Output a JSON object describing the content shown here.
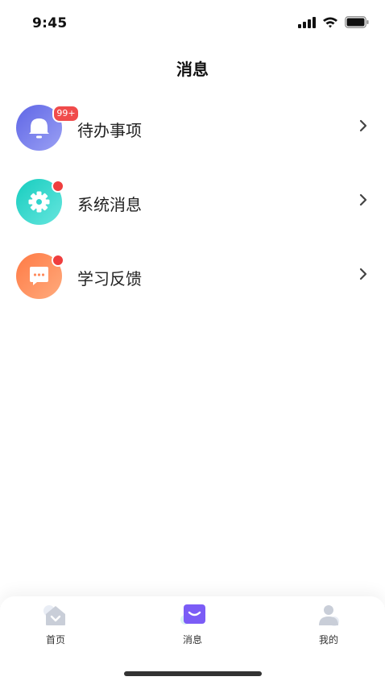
{
  "status_bar": {
    "time": "9:45"
  },
  "header": {
    "title": "消息"
  },
  "messages": [
    {
      "label": "待办事项",
      "icon": "bell-icon",
      "badge": "99+",
      "color": "#6e73ea"
    },
    {
      "label": "系统消息",
      "icon": "gear-icon",
      "color": "#2fd4cd"
    },
    {
      "label": "学习反馈",
      "icon": "chat-bubble-icon",
      "color": "#ff8a5c"
    }
  ],
  "tabbar": {
    "items": [
      {
        "label": "首页",
        "icon": "home-icon"
      },
      {
        "label": "消息",
        "icon": "message-icon",
        "active": true,
        "color": "#7b5cf6"
      },
      {
        "label": "我的",
        "icon": "profile-icon"
      }
    ]
  }
}
